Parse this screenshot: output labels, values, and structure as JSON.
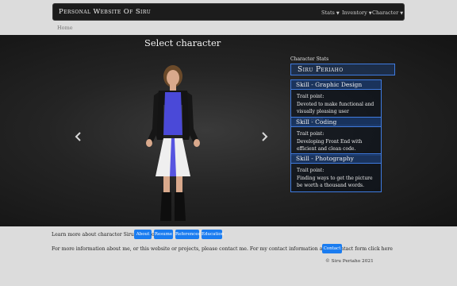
{
  "navbar": {
    "brand": "Personal Website Of Siru",
    "items": [
      {
        "label": "Stats"
      },
      {
        "label": "Inventory"
      },
      {
        "label": "Character"
      }
    ]
  },
  "breadcrumb": {
    "home": "Home"
  },
  "hero": {
    "title": "Select character",
    "character_label": "Character Stats",
    "character_name": "Siru Periaho",
    "skills": [
      {
        "title": "Skill - Graphic Design",
        "trait_title": "Trait point:",
        "trait_text": "Devoted to make functional and visually pleasing user experience."
      },
      {
        "title": "Skill - Coding",
        "trait_title": "Trait point:",
        "trait_text": "Developing Front End with efficient and clean code."
      },
      {
        "title": "Skill - Photography",
        "trait_title": "Trait point:",
        "trait_text": "Finding ways to get the picture be worth a thousand words."
      }
    ]
  },
  "learn": {
    "text": "Learn more about character Siru Periaho",
    "buttons": [
      "About",
      "Resume",
      "References",
      "Education"
    ]
  },
  "contact": {
    "text": "For more information about me, or this website or projects, please contact me. For my contact information and a contact form click here",
    "button": "Contact"
  },
  "footer": {
    "copyright": "© Siru Periaho 2021"
  },
  "colors": {
    "accent": "#1a7cf0",
    "panel_border": "#3f7be0",
    "navbar": "#1c1c1c"
  }
}
